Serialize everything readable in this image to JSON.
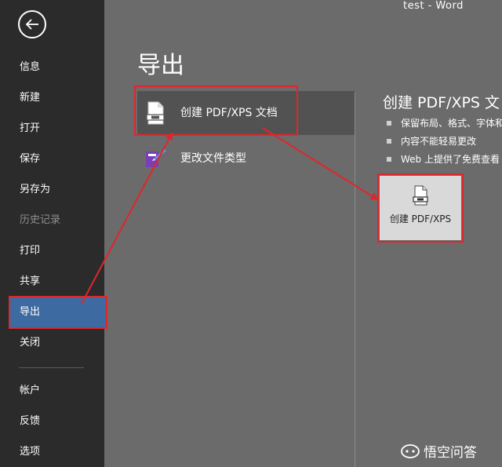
{
  "window": {
    "title": "test  -  Word"
  },
  "sidebar": {
    "back_icon": "back-arrow-icon",
    "items": [
      {
        "label": "信息"
      },
      {
        "label": "新建"
      },
      {
        "label": "打开"
      },
      {
        "label": "保存"
      },
      {
        "label": "另存为"
      },
      {
        "label": "历史记录",
        "disabled": true
      },
      {
        "label": "打印"
      },
      {
        "label": "共享"
      },
      {
        "label": "导出",
        "active": true
      },
      {
        "label": "关闭"
      },
      {
        "label": "帐户"
      },
      {
        "label": "反馈"
      },
      {
        "label": "选项"
      }
    ]
  },
  "main": {
    "title": "导出",
    "options": [
      {
        "label": "创建 PDF/XPS 文档",
        "icon": "pdf-document-icon",
        "selected": true
      },
      {
        "label": "更改文件类型",
        "icon": "change-file-type-icon"
      }
    ]
  },
  "detail": {
    "title": "创建 PDF/XPS 文",
    "bullets": [
      "保留布局、格式、字体和",
      "内容不能轻易更改",
      "Web 上提供了免费查看"
    ],
    "button_label": "创建 PDF/XPS"
  },
  "annotation_color": "#e0262b",
  "watermark": {
    "text": "悟空问答"
  }
}
